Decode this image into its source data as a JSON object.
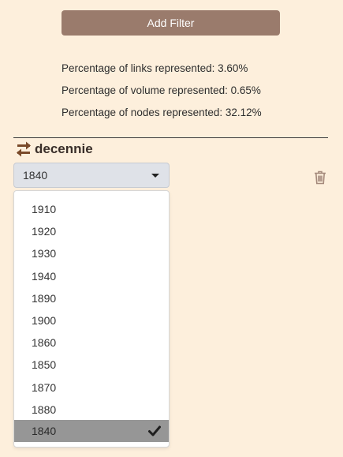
{
  "add_filter_label": "Add Filter",
  "stats": [
    "Percentage of links represented: 3.60%",
    "Percentage of volume represented: 0.65%",
    "Percentage of nodes represented: 32.12%"
  ],
  "filter": {
    "name": "decennie",
    "selected": "1840",
    "options": [
      "1910",
      "1920",
      "1930",
      "1940",
      "1890",
      "1900",
      "1860",
      "1850",
      "1870",
      "1880",
      "1840"
    ]
  },
  "icons": {
    "swap": "swap-arrows-icon",
    "trash": "trash-icon",
    "check": "checkmark-icon",
    "caret": "caret-down-icon"
  },
  "colors": {
    "background": "#fdefdc",
    "button": "#9a7b6c",
    "select_bg": "#dfe2e8",
    "selected_option": "#969696",
    "swap_icon": "#7a4a2a",
    "trash_icon": "#a58a7c"
  }
}
